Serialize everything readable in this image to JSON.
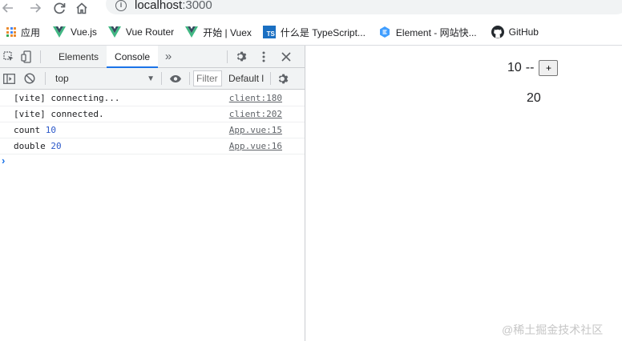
{
  "browser": {
    "url_host": "localhost",
    "url_port": ":3000"
  },
  "bookmarks": [
    {
      "label": "应用",
      "icon": "apps-grid-icon"
    },
    {
      "label": "Vue.js",
      "icon": "vue-logo-icon"
    },
    {
      "label": "Vue Router",
      "icon": "vue-logo-icon"
    },
    {
      "label": "开始 | Vuex",
      "icon": "vue-logo-icon"
    },
    {
      "label": "什么是 TypeScript...",
      "icon": "typescript-icon"
    },
    {
      "label": "Element - 网站快...",
      "icon": "element-icon"
    },
    {
      "label": "GitHub",
      "icon": "github-icon"
    }
  ],
  "devtools": {
    "tabs": [
      "Elements",
      "Console"
    ],
    "active_tab": "Console",
    "context": "top",
    "filter_placeholder": "Filter",
    "levels_label": "Default l",
    "typescript_badge": "TS",
    "console": [
      {
        "text": "[vite] connecting...",
        "value": "",
        "source": "client:180"
      },
      {
        "text": "[vite] connected.",
        "value": "",
        "source": "client:202"
      },
      {
        "text": "count",
        "value": "10",
        "source": "App.vue:15"
      },
      {
        "text": "double",
        "value": "20",
        "source": "App.vue:16"
      }
    ],
    "prompt": "›"
  },
  "page": {
    "count": "10",
    "separator": "--",
    "plus_label": "+",
    "double": "20"
  },
  "watermark": "@稀土掘金技术社区",
  "colors": {
    "accent": "#1a73e8",
    "console_number": "#2c59c9",
    "vue_green": "#41b883",
    "vue_dark": "#35495e"
  }
}
